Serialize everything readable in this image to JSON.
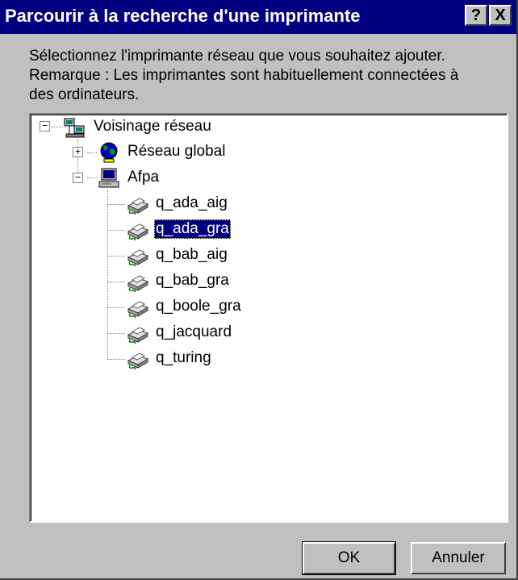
{
  "window": {
    "title": "Parcourir à la recherche d'une imprimante",
    "help_label": "?",
    "close_label": "X"
  },
  "instructions": {
    "line1": "Sélectionnez l'imprimante réseau que vous souhaitez ajouter.",
    "line2": "Remarque : Les imprimantes sont habituellement connectées à",
    "line3": "des ordinateurs."
  },
  "tree": {
    "root": {
      "label": "Voisinage réseau",
      "icon": "network-neighborhood-icon",
      "expander": "−"
    },
    "global": {
      "label": "Réseau global",
      "icon": "globe-icon",
      "expander": "+"
    },
    "afpa": {
      "label": "Afpa",
      "icon": "computer-icon",
      "expander": "−"
    },
    "printers": [
      {
        "label": "q_ada_aig",
        "selected": false
      },
      {
        "label": "q_ada_gra",
        "selected": true
      },
      {
        "label": "q_bab_aig",
        "selected": false
      },
      {
        "label": "q_bab_gra",
        "selected": false
      },
      {
        "label": "q_boole_gra",
        "selected": false
      },
      {
        "label": "q_jacquard",
        "selected": false
      },
      {
        "label": "q_turing",
        "selected": false
      }
    ]
  },
  "buttons": {
    "ok": "OK",
    "cancel": "Annuler"
  },
  "colors": {
    "titlebar": "#000080",
    "dialog": "#c0c0c0",
    "selection": "#000080"
  }
}
